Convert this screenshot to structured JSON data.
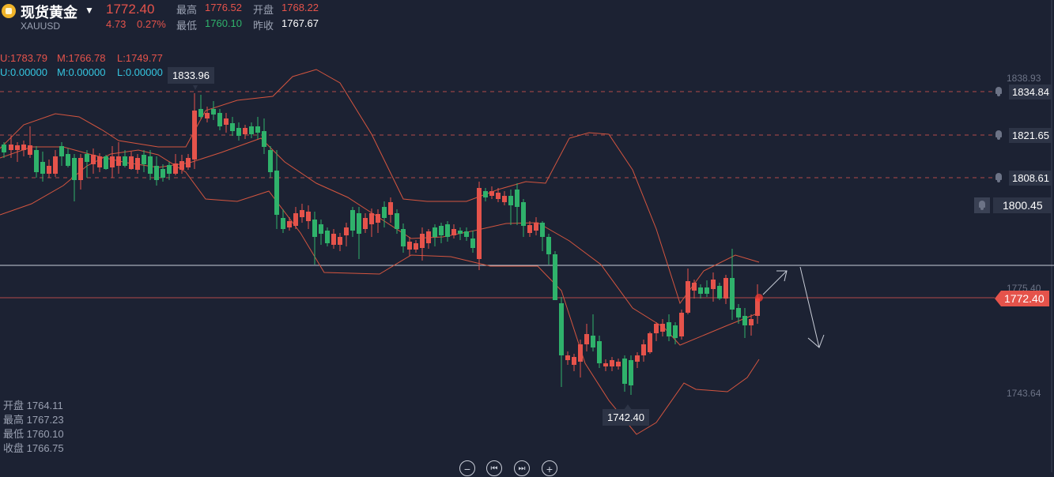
{
  "header": {
    "symbol_name": "现货黄金",
    "symbol_code": "XAUUSD",
    "last_price": "1772.40",
    "change": "4.73",
    "change_pct": "0.27%",
    "stats": {
      "high_label": "最高",
      "high": "1776.52",
      "open_label": "开盘",
      "open": "1768.22",
      "low_label": "最低",
      "low": "1760.10",
      "prev_close_label": "昨收",
      "prev_close": "1767.67"
    }
  },
  "indicators": {
    "row1": {
      "u": "U:1783.79",
      "m": "M:1766.78",
      "l": "L:1749.77"
    },
    "row2": {
      "u": "U:0.00000",
      "m": "M:0.00000",
      "l": "L:0.00000"
    }
  },
  "axis": {
    "top_label": "1838.93",
    "mid_label": "1775.40",
    "bottom_label": "1743.64"
  },
  "alerts": [
    "1834.84",
    "1821.65",
    "1808.61"
  ],
  "alert_active": "1800.45",
  "current_price_tag": "1772.40",
  "annotations": {
    "high_marker": "1833.96",
    "low_marker": "1742.40"
  },
  "ohlc_panel": {
    "open_label": "开盘",
    "open": "1764.11",
    "high_label": "最高",
    "high": "1767.23",
    "low_label": "最低",
    "low": "1760.10",
    "close_label": "收盘",
    "close": "1766.75"
  },
  "controls": {
    "zoom_out": "−",
    "prev": "⏮",
    "next": "⏭",
    "zoom_in": "+"
  },
  "colors": {
    "up": "#e5534b",
    "down": "#2fb26b",
    "band": "#d4553f",
    "background": "#1c2233"
  }
}
